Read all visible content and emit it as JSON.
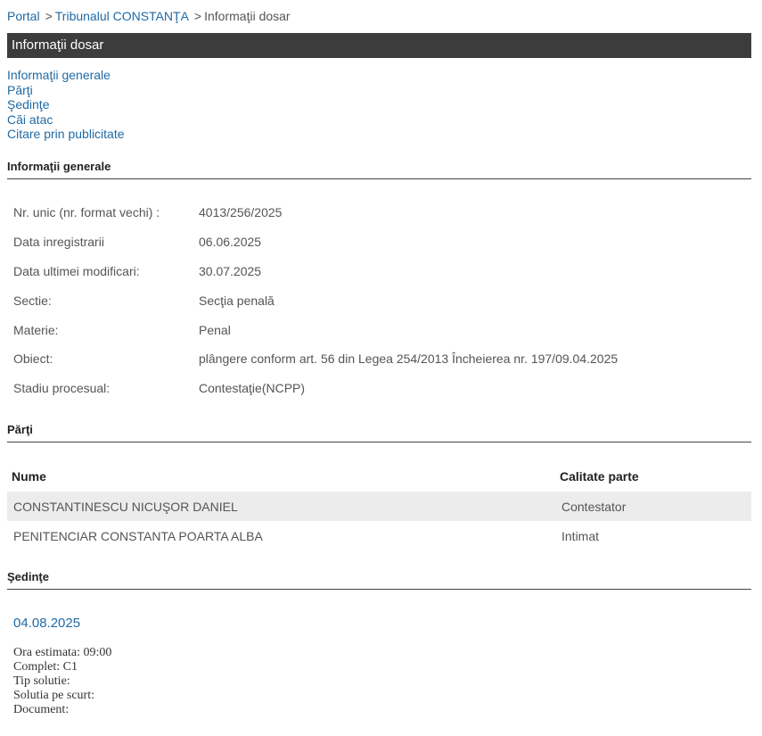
{
  "breadcrumb": {
    "portal": "Portal",
    "court": "Tribunalul CONSTANŢA",
    "current": "Informaţii dosar",
    "separator": ">"
  },
  "title_bar": "Informaţii dosar",
  "quick_nav": [
    "Informaţii generale",
    "Părţi",
    "Şedinţe",
    "Căi atac",
    "Citare prin publicitate"
  ],
  "sections": {
    "general": "Informaţii generale",
    "parti": "Părţi",
    "sedinte": "Şedinţe"
  },
  "general_info": [
    {
      "label": "Nr. unic (nr. format vechi) :",
      "value": "4013/256/2025"
    },
    {
      "label": "Data inregistrarii",
      "value": "06.06.2025"
    },
    {
      "label": "Data ultimei modificari:",
      "value": "30.07.2025"
    },
    {
      "label": "Sectie:",
      "value": "Secţia penală"
    },
    {
      "label": "Materie:",
      "value": "Penal"
    },
    {
      "label": "Obiect:",
      "value": "plângere conform art. 56 din Legea 254/2013 Încheierea nr. 197/09.04.2025"
    },
    {
      "label": "Stadiu procesual:",
      "value": "Contestaţie(NCPP)"
    }
  ],
  "parti": {
    "headers": {
      "name": "Nume",
      "role": "Calitate parte"
    },
    "rows": [
      {
        "name": "CONSTANTINESCU NICUŞOR DANIEL",
        "role": "Contestator"
      },
      {
        "name": "PENITENCIAR CONSTANTA POARTA ALBA",
        "role": "Intimat"
      }
    ]
  },
  "sedinta": {
    "date": "04.08.2025",
    "details": [
      "Ora estimata: 09:00",
      "Complet: C1",
      "Tip solutie:",
      "Solutia pe scurt:",
      "Document:"
    ]
  }
}
